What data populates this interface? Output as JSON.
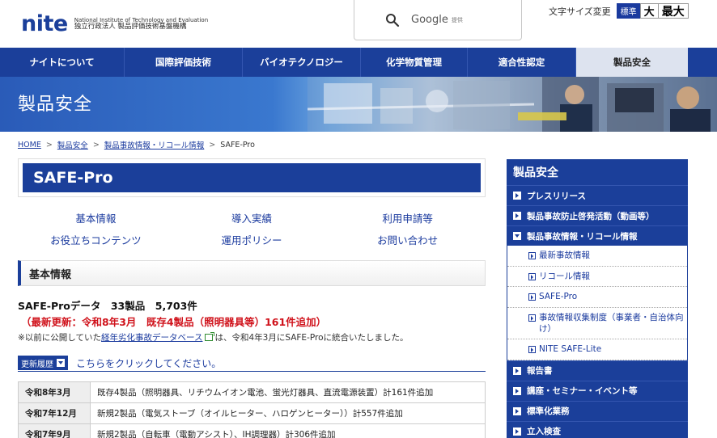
{
  "header": {
    "logo_word": "nite",
    "logo_en": "National Institute of Technology and Evaluation",
    "logo_ja": "独立行政法人 製品評価技術基盤機構",
    "search_label": "Google",
    "search_sub": "提供",
    "fontsize_label": "文字サイズ変更",
    "fontsize_options": [
      "標準",
      "大",
      "最大"
    ]
  },
  "nav": {
    "items": [
      "ナイトについて",
      "国際評価技術",
      "バイオテクノロジー",
      "化学物質管理",
      "適合性認定",
      "製品安全"
    ],
    "active_index": 5
  },
  "banner": {
    "title": "製品安全"
  },
  "breadcrumb": [
    "HOME",
    "製品安全",
    "製品事故情報・リコール情報",
    "SAFE-Pro"
  ],
  "main": {
    "title": "SAFE-Pro",
    "quicklinks": [
      "基本情報",
      "導入実績",
      "利用申請等",
      "お役立ちコンテンツ",
      "運用ポリシー",
      "お問い合わせ"
    ],
    "section_title": "基本情報",
    "data_line": "SAFE-Proデータ　33製品　5,703件",
    "update_line": "（最新更新：令和8年3月　既存4製品（照明器具等）161件追加）",
    "note_prefix": "※以前に公開していた",
    "note_link": "経年劣化事故データベース",
    "note_suffix": "は、令和4年3月にSAFE-Proに統合いたしました。",
    "history_badge": "更新履歴",
    "history_link": "こちらをクリックしてください。",
    "history": [
      {
        "date": "令和8年3月",
        "text": "既存4製品（照明器具、リチウムイオン電池、蛍光灯器具、直流電源装置）計161件追加"
      },
      {
        "date": "令和7年12月",
        "text": "新規2製品（電気ストーブ（オイルヒーター、ハロゲンヒーター））計557件追加"
      },
      {
        "date": "令和7年9月",
        "text": "新規2製品（自転車（電動アシスト）、IH調理器）計306件追加"
      }
    ]
  },
  "sidebar": {
    "title": "製品安全",
    "items_before": [
      "プレスリリース",
      "製品事故防止啓発活動（動画等）"
    ],
    "open_item": "製品事故情報・リコール情報",
    "sub_items": [
      "最新事故情報",
      "リコール情報",
      "SAFE-Pro",
      "事故情報収集制度（事業者・自治体向け）",
      "NITE SAFE-Lite"
    ],
    "items_after": [
      "報告書",
      "講座・セミナー・イベント等",
      "標準化業務",
      "立入検査"
    ]
  }
}
